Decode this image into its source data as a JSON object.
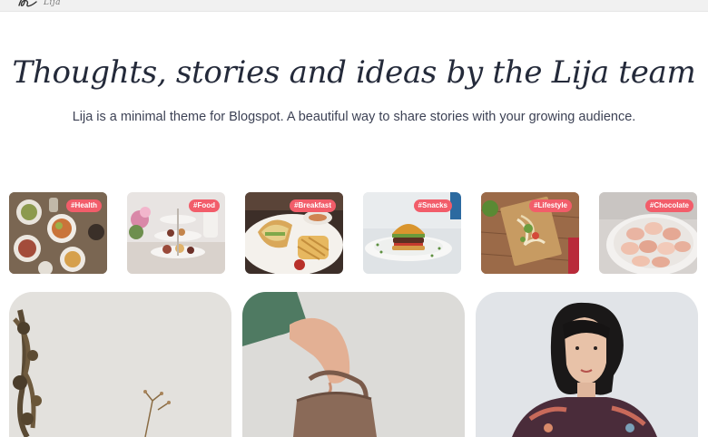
{
  "header": {
    "logo_text": "Lija",
    "logo_icon": "signature-logo-icon"
  },
  "hero": {
    "title": "Thoughts, stories and ideas by the Lija team",
    "subtitle": "Lija is a minimal theme for Blogspot. A beautiful way to share stories with your growing audience."
  },
  "categories": [
    {
      "tag": "#Health",
      "image": "healthy-food-table"
    },
    {
      "tag": "#Food",
      "image": "afternoon-tea-stand"
    },
    {
      "tag": "#Breakfast",
      "image": "sandwich-and-waffles"
    },
    {
      "tag": "#Snacks",
      "image": "burger-on-plate"
    },
    {
      "tag": "#Lifestyle",
      "image": "noodles-on-board"
    },
    {
      "tag": "#Chocolate",
      "image": "macarons-bowl"
    }
  ],
  "posts": [
    {
      "image": "dried-flowers-wall"
    },
    {
      "image": "hand-holding-kettle"
    },
    {
      "image": "woman-portrait-bob-hair"
    }
  ],
  "colors": {
    "tag_bg": "#f25d6a",
    "title": "#242a3a",
    "text": "#3d4255",
    "topbar": "#f1f1f1"
  }
}
